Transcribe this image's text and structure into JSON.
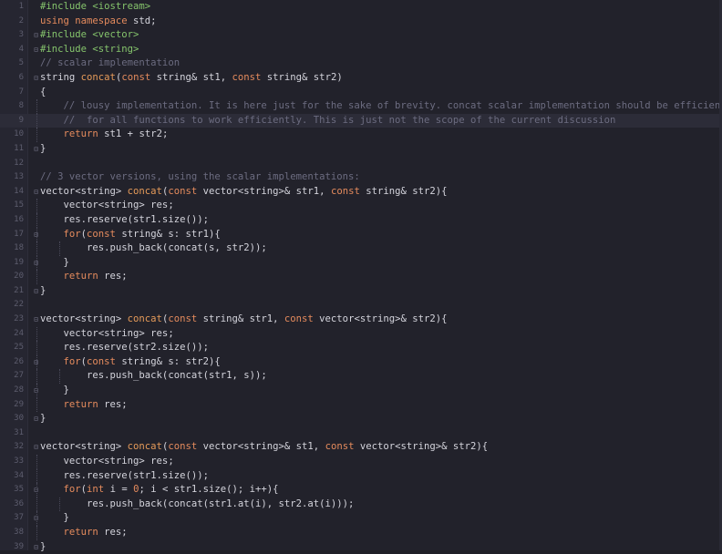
{
  "editor": {
    "colors": {
      "background": "#22222b",
      "keyword": "#e58b5d",
      "preprocessor": "#85c46c",
      "comment": "#6c6c80",
      "function": "#e59a59",
      "text": "#d4d4dc"
    },
    "current_line": 9,
    "lines": [
      {
        "n": "1",
        "fold": "",
        "tokens": [
          {
            "c": "pp",
            "t": "#include <iostream>"
          }
        ]
      },
      {
        "n": "2",
        "fold": "",
        "tokens": [
          {
            "c": "kw",
            "t": "using namespace"
          },
          {
            "c": "pl",
            "t": " std;"
          }
        ]
      },
      {
        "n": "3",
        "fold": "⊟",
        "tokens": [
          {
            "c": "pp",
            "t": "#include <vector>"
          }
        ]
      },
      {
        "n": "4",
        "fold": "⊟",
        "tokens": [
          {
            "c": "pp",
            "t": "#include <string>"
          }
        ]
      },
      {
        "n": "5",
        "fold": "",
        "tokens": [
          {
            "c": "cm",
            "t": "// scalar implementation"
          }
        ]
      },
      {
        "n": "6",
        "fold": "⊟",
        "tokens": [
          {
            "c": "pl",
            "t": "string "
          },
          {
            "c": "fn",
            "t": "concat"
          },
          {
            "c": "pl",
            "t": "("
          },
          {
            "c": "kw",
            "t": "const"
          },
          {
            "c": "pl",
            "t": " string& st1, "
          },
          {
            "c": "kw",
            "t": "const"
          },
          {
            "c": "pl",
            "t": " string& str2)"
          }
        ]
      },
      {
        "n": "7",
        "fold": "",
        "tokens": [
          {
            "c": "pl",
            "t": "{"
          }
        ]
      },
      {
        "n": "8",
        "fold": "",
        "tokens": [
          {
            "c": "cm",
            "t": "    // lousy implementation. It is here just for the sake of brevity. concat scalar implementation should be efficient"
          }
        ]
      },
      {
        "n": "9",
        "fold": "",
        "tokens": [
          {
            "c": "cm",
            "t": "    //  for all functions to work efficiently. This is just not the scope of the current discussion"
          }
        ]
      },
      {
        "n": "10",
        "fold": "",
        "tokens": [
          {
            "c": "pl",
            "t": "    "
          },
          {
            "c": "kw",
            "t": "return"
          },
          {
            "c": "pl",
            "t": " st1 + str2;"
          }
        ]
      },
      {
        "n": "11",
        "fold": "⊟",
        "tokens": [
          {
            "c": "pl",
            "t": "}"
          }
        ]
      },
      {
        "n": "12",
        "fold": "",
        "tokens": []
      },
      {
        "n": "13",
        "fold": "",
        "tokens": [
          {
            "c": "cm",
            "t": "// 3 vector versions, using the scalar implementations:"
          }
        ]
      },
      {
        "n": "14",
        "fold": "⊟",
        "tokens": [
          {
            "c": "pl",
            "t": "vector<string> "
          },
          {
            "c": "fn",
            "t": "concat"
          },
          {
            "c": "pl",
            "t": "("
          },
          {
            "c": "kw",
            "t": "const"
          },
          {
            "c": "pl",
            "t": " vector<string>& str1, "
          },
          {
            "c": "kw",
            "t": "const"
          },
          {
            "c": "pl",
            "t": " string& str2){"
          }
        ]
      },
      {
        "n": "15",
        "fold": "",
        "tokens": [
          {
            "c": "pl",
            "t": "    vector<string> res;"
          }
        ]
      },
      {
        "n": "16",
        "fold": "",
        "tokens": [
          {
            "c": "pl",
            "t": "    res.reserve(str1.size());"
          }
        ]
      },
      {
        "n": "17",
        "fold": "⊟",
        "tokens": [
          {
            "c": "pl",
            "t": "    "
          },
          {
            "c": "kw",
            "t": "for"
          },
          {
            "c": "pl",
            "t": "("
          },
          {
            "c": "kw",
            "t": "const"
          },
          {
            "c": "pl",
            "t": " string& s: str1){"
          }
        ]
      },
      {
        "n": "18",
        "fold": "",
        "tokens": [
          {
            "c": "pl",
            "t": "        res.push_back(concat(s, str2));"
          }
        ]
      },
      {
        "n": "19",
        "fold": "⊟",
        "tokens": [
          {
            "c": "pl",
            "t": "    }"
          }
        ]
      },
      {
        "n": "20",
        "fold": "",
        "tokens": [
          {
            "c": "pl",
            "t": "    "
          },
          {
            "c": "kw",
            "t": "return"
          },
          {
            "c": "pl",
            "t": " res;"
          }
        ]
      },
      {
        "n": "21",
        "fold": "⊟",
        "tokens": [
          {
            "c": "pl",
            "t": "}"
          }
        ]
      },
      {
        "n": "22",
        "fold": "",
        "tokens": []
      },
      {
        "n": "23",
        "fold": "⊟",
        "tokens": [
          {
            "c": "pl",
            "t": "vector<string> "
          },
          {
            "c": "fn",
            "t": "concat"
          },
          {
            "c": "pl",
            "t": "("
          },
          {
            "c": "kw",
            "t": "const"
          },
          {
            "c": "pl",
            "t": " string& str1, "
          },
          {
            "c": "kw",
            "t": "const"
          },
          {
            "c": "pl",
            "t": " vector<string>& str2){"
          }
        ]
      },
      {
        "n": "24",
        "fold": "",
        "tokens": [
          {
            "c": "pl",
            "t": "    vector<string> res;"
          }
        ]
      },
      {
        "n": "25",
        "fold": "",
        "tokens": [
          {
            "c": "pl",
            "t": "    res.reserve(str2.size());"
          }
        ]
      },
      {
        "n": "26",
        "fold": "⊟",
        "tokens": [
          {
            "c": "pl",
            "t": "    "
          },
          {
            "c": "kw",
            "t": "for"
          },
          {
            "c": "pl",
            "t": "("
          },
          {
            "c": "kw",
            "t": "const"
          },
          {
            "c": "pl",
            "t": " string& s: str2){"
          }
        ]
      },
      {
        "n": "27",
        "fold": "",
        "tokens": [
          {
            "c": "pl",
            "t": "        res.push_back(concat(str1, s));"
          }
        ]
      },
      {
        "n": "28",
        "fold": "⊟",
        "tokens": [
          {
            "c": "pl",
            "t": "    }"
          }
        ]
      },
      {
        "n": "29",
        "fold": "",
        "tokens": [
          {
            "c": "pl",
            "t": "    "
          },
          {
            "c": "kw",
            "t": "return"
          },
          {
            "c": "pl",
            "t": " res;"
          }
        ]
      },
      {
        "n": "30",
        "fold": "⊟",
        "tokens": [
          {
            "c": "pl",
            "t": "}"
          }
        ]
      },
      {
        "n": "31",
        "fold": "",
        "tokens": []
      },
      {
        "n": "32",
        "fold": "⊟",
        "tokens": [
          {
            "c": "pl",
            "t": "vector<string> "
          },
          {
            "c": "fn",
            "t": "concat"
          },
          {
            "c": "pl",
            "t": "("
          },
          {
            "c": "kw",
            "t": "const"
          },
          {
            "c": "pl",
            "t": " vector<string>& st1, "
          },
          {
            "c": "kw",
            "t": "const"
          },
          {
            "c": "pl",
            "t": " vector<string>& str2){"
          }
        ]
      },
      {
        "n": "33",
        "fold": "",
        "tokens": [
          {
            "c": "pl",
            "t": "    vector<string> res;"
          }
        ]
      },
      {
        "n": "34",
        "fold": "",
        "tokens": [
          {
            "c": "pl",
            "t": "    res.reserve(str1.size());"
          }
        ]
      },
      {
        "n": "35",
        "fold": "⊟",
        "tokens": [
          {
            "c": "pl",
            "t": "    "
          },
          {
            "c": "kw",
            "t": "for"
          },
          {
            "c": "pl",
            "t": "("
          },
          {
            "c": "kw",
            "t": "int"
          },
          {
            "c": "pl",
            "t": " i = "
          },
          {
            "c": "num",
            "t": "0"
          },
          {
            "c": "pl",
            "t": "; i < str1.size(); i++){"
          }
        ]
      },
      {
        "n": "36",
        "fold": "",
        "tokens": [
          {
            "c": "pl",
            "t": "        res.push_back(concat(str1.at(i), str2.at(i)));"
          }
        ]
      },
      {
        "n": "37",
        "fold": "⊟",
        "tokens": [
          {
            "c": "pl",
            "t": "    }"
          }
        ]
      },
      {
        "n": "38",
        "fold": "",
        "tokens": [
          {
            "c": "pl",
            "t": "    "
          },
          {
            "c": "kw",
            "t": "return"
          },
          {
            "c": "pl",
            "t": " res;"
          }
        ]
      },
      {
        "n": "39",
        "fold": "⊟",
        "tokens": [
          {
            "c": "pl",
            "t": "}"
          }
        ]
      }
    ]
  }
}
